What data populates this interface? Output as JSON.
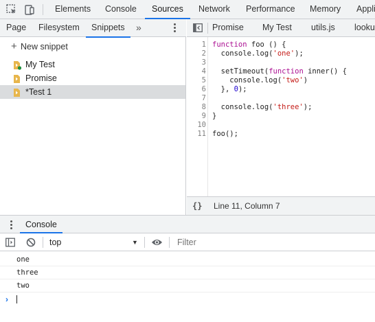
{
  "main_tabs": [
    "Elements",
    "Console",
    "Sources",
    "Network",
    "Performance",
    "Memory",
    "Appli"
  ],
  "active_main_tab": "Sources",
  "navigator": {
    "tabs": [
      "Page",
      "Filesystem",
      "Snippets"
    ],
    "active_tab": "Snippets",
    "more_label": "»",
    "new_snippet_label": "New snippet",
    "snippets": [
      {
        "label": "My Test",
        "has_run_badge": true
      },
      {
        "label": "Promise",
        "has_run_badge": false
      },
      {
        "label": "*Test 1",
        "has_run_badge": false,
        "selected": true
      }
    ]
  },
  "editor": {
    "file_tabs": [
      "Promise",
      "My Test",
      "utils.js",
      "looku"
    ],
    "line_numbers": [
      "1",
      "2",
      "3",
      "4",
      "5",
      "6",
      "7",
      "8",
      "9",
      "10",
      "11"
    ],
    "code_lines": [
      "function foo () {",
      "  console.log('one');",
      "",
      "  setTimeout(function inner() {",
      "    console.log('two')",
      "  }, 0);",
      "",
      "  console.log('three');",
      "}",
      "",
      "foo();"
    ],
    "status_braces": "{}",
    "cursor_position": "Line 11, Column 7"
  },
  "drawer": {
    "title": "Console",
    "context": "top",
    "filter_placeholder": "Filter",
    "messages": [
      "one",
      "three",
      "two"
    ],
    "prompt_symbol": "›"
  },
  "icons": {
    "inspect": "inspect-element-icon",
    "device": "device-toolbar-icon",
    "file": "snippet-file-icon"
  },
  "colors": {
    "accent": "#1a73e8",
    "keyword": "#aa0d91",
    "string": "#c41a16",
    "number": "#1c00cf",
    "file_icon": "#e8b64c",
    "run_badge": "#1e8e3e"
  }
}
